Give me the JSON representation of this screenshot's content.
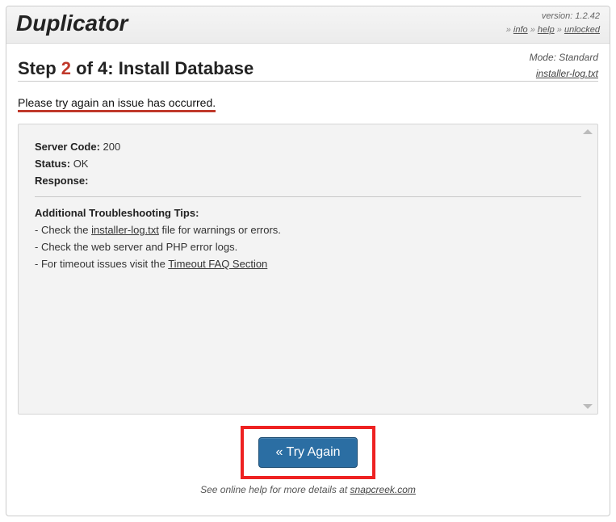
{
  "header": {
    "logo": "Duplicator",
    "version_label": "version:",
    "version": "1.2.42",
    "sep": "»",
    "info": "info",
    "help": "help",
    "unlocked": "unlocked"
  },
  "mode": {
    "label": "Mode:",
    "value": "Standard"
  },
  "step": {
    "prefix": "Step ",
    "num": "2",
    "mid": " of 4: ",
    "title": "Install Database"
  },
  "log_link": "installer-log.txt",
  "error_msg": "Please try again an issue has occurred.",
  "panel": {
    "server_code_label": "Server Code:",
    "server_code_value": "200",
    "status_label": "Status:",
    "status_value": "OK",
    "response_label": "Response:",
    "tips_heading": "Additional Troubleshooting Tips:",
    "tip1_pre": "- Check the ",
    "tip1_link": "installer-log.txt",
    "tip1_post": " file for warnings or errors.",
    "tip2": "- Check the web server and PHP error logs.",
    "tip3_pre": "- For timeout issues visit the ",
    "tip3_link": "Timeout FAQ Section"
  },
  "button": {
    "label": "« Try Again"
  },
  "footer": {
    "text": "See online help for more details at ",
    "link": "snapcreek.com"
  }
}
